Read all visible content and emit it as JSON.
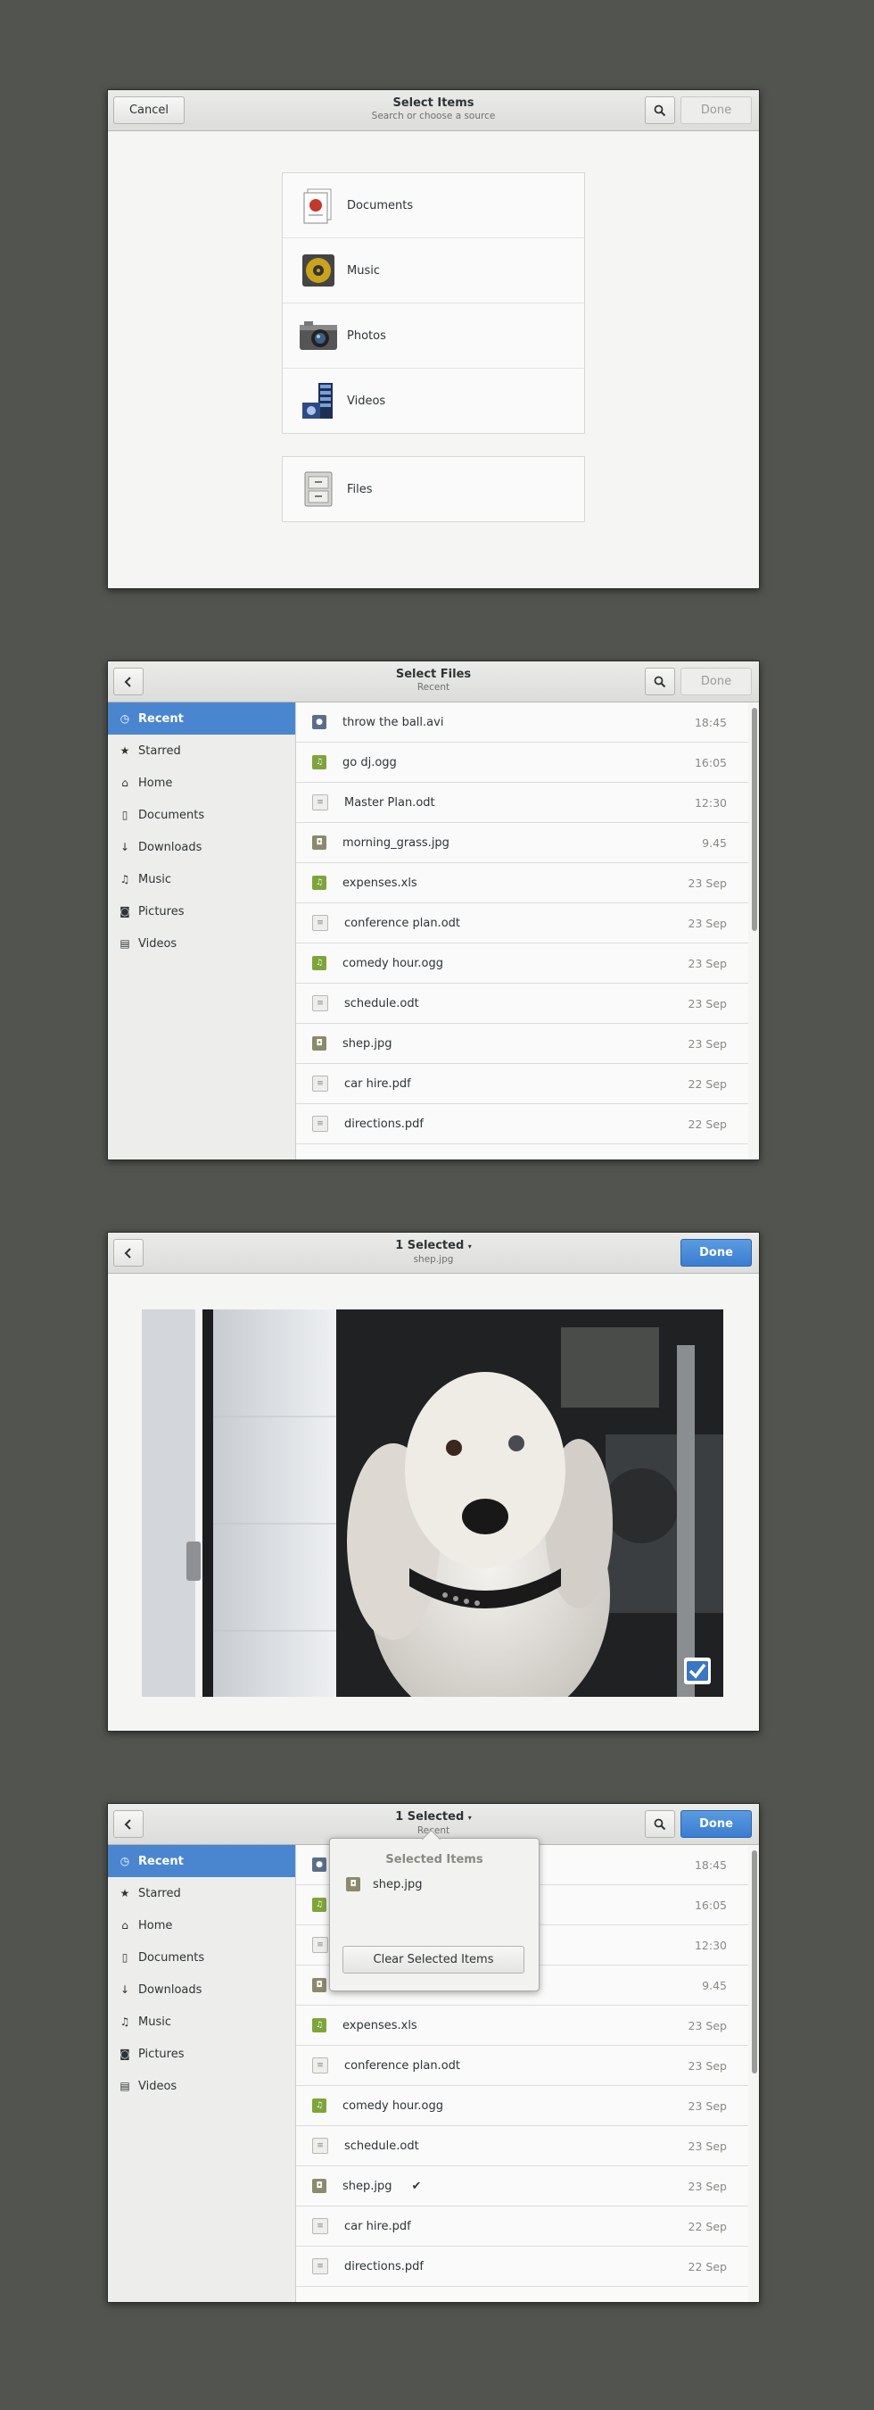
{
  "panel1": {
    "title": "Select Items",
    "subtitle": "Search or choose a source",
    "cancel_label": "Cancel",
    "done_label": "Done",
    "sources": [
      {
        "label": "Documents",
        "icon": "documents-icon"
      },
      {
        "label": "Music",
        "icon": "music-icon"
      },
      {
        "label": "Photos",
        "icon": "photos-icon"
      },
      {
        "label": "Videos",
        "icon": "videos-icon"
      }
    ],
    "files_label": "Files"
  },
  "panel2": {
    "title": "Select Files",
    "subtitle": "Recent",
    "done_label": "Done"
  },
  "sidebar": {
    "items": [
      {
        "label": "Recent",
        "icon": "clock-icon",
        "glyph": "◷"
      },
      {
        "label": "Starred",
        "icon": "star-icon",
        "glyph": "★"
      },
      {
        "label": "Home",
        "icon": "home-icon",
        "glyph": "⌂"
      },
      {
        "label": "Documents",
        "icon": "document-icon",
        "glyph": "▯"
      },
      {
        "label": "Downloads",
        "icon": "download-icon",
        "glyph": "↓"
      },
      {
        "label": "Music",
        "icon": "music-note-icon",
        "glyph": "♫"
      },
      {
        "label": "Pictures",
        "icon": "camera-icon",
        "glyph": "◙"
      },
      {
        "label": "Videos",
        "icon": "film-icon",
        "glyph": "▤"
      }
    ]
  },
  "files": [
    {
      "name": "throw the ball.avi",
      "time": "18:45",
      "type": "avi"
    },
    {
      "name": "go dj.ogg",
      "time": "16:05",
      "type": "ogg"
    },
    {
      "name": "Master Plan.odt",
      "time": "12:30",
      "type": "doc"
    },
    {
      "name": "morning_grass.jpg",
      "time": "9.45",
      "type": "img"
    },
    {
      "name": "expenses.xls",
      "time": "23 Sep",
      "type": "ogg"
    },
    {
      "name": "conference plan.odt",
      "time": "23 Sep",
      "type": "doc"
    },
    {
      "name": "comedy hour.ogg",
      "time": "23 Sep",
      "type": "ogg"
    },
    {
      "name": "schedule.odt",
      "time": "23 Sep",
      "type": "doc"
    },
    {
      "name": "shep.jpg",
      "time": "23 Sep",
      "type": "img"
    },
    {
      "name": "car hire.pdf",
      "time": "22 Sep",
      "type": "doc"
    },
    {
      "name": "directions.pdf",
      "time": "22 Sep",
      "type": "doc"
    }
  ],
  "panel3": {
    "title": "1 Selected",
    "subtitle": "shep.jpg",
    "done_label": "Done"
  },
  "panel4": {
    "title": "1 Selected",
    "subtitle": "Recent",
    "done_label": "Done",
    "popover_title": "Selected Items",
    "popover_item": "shep.jpg",
    "clear_label": "Clear Selected Items",
    "checked_file": "shep.jpg"
  },
  "colors": {
    "background": "#52544f",
    "accent": "#4a86cf",
    "done_blue": "#3a7ed0"
  }
}
